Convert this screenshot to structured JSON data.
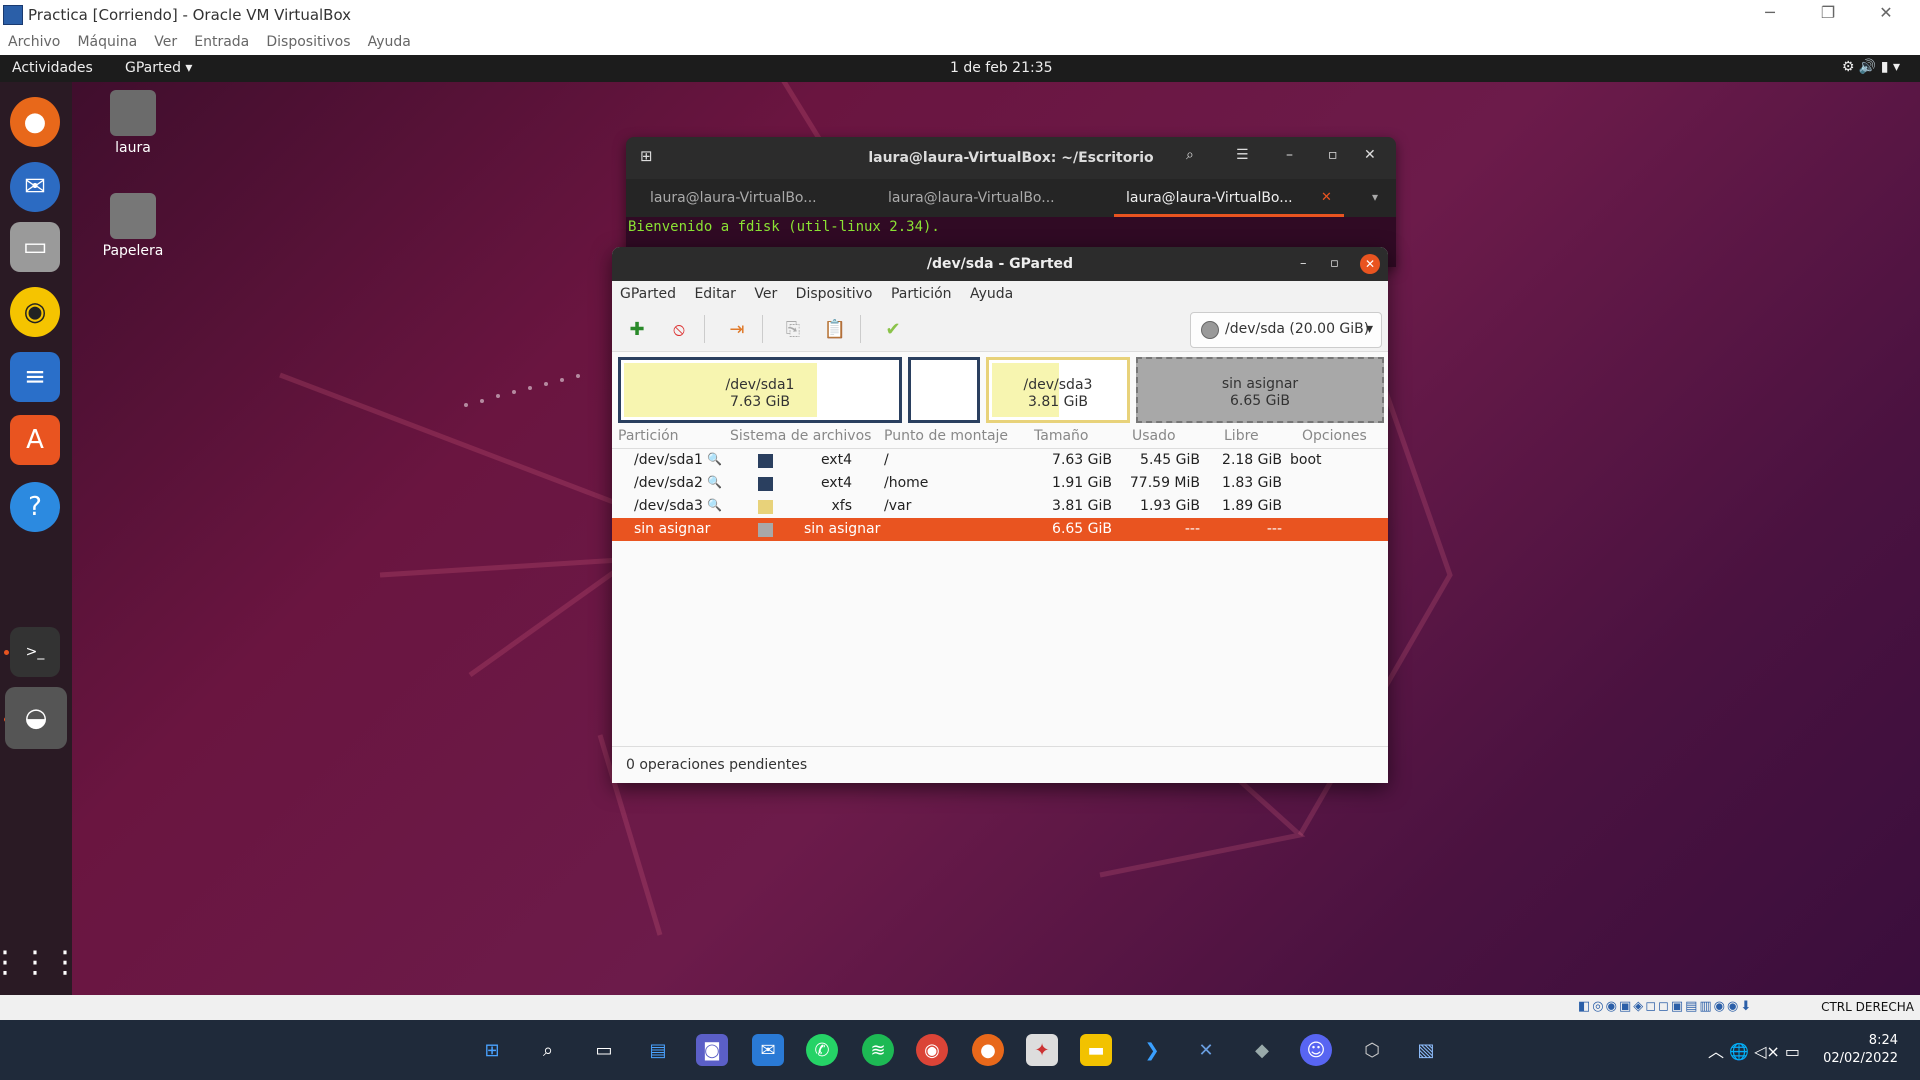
{
  "vbox": {
    "title": "Practica [Corriendo] - Oracle VM VirtualBox",
    "menu": [
      "Archivo",
      "Máquina",
      "Ver",
      "Entrada",
      "Dispositivos",
      "Ayuda"
    ],
    "host_key": "CTRL DERECHA"
  },
  "ubuntu": {
    "activities": "Actividades",
    "app_menu": "GParted ▾",
    "clock": "1 de feb  21:35"
  },
  "desktop": {
    "home_label": "laura",
    "trash_label": "Papelera"
  },
  "terminal": {
    "title": "laura@laura-VirtualBox: ~/Escritorio",
    "tabs": [
      "laura@laura-VirtualBo...",
      "laura@laura-VirtualBo...",
      "laura@laura-VirtualBo..."
    ],
    "output": "Bienvenido a fdisk (util-linux 2.34)."
  },
  "gparted": {
    "title": "/dev/sda - GParted",
    "menu": [
      "GParted",
      "Editar",
      "Ver",
      "Dispositivo",
      "Partición",
      "Ayuda"
    ],
    "device": "/dev/sda (20.00 GiB)",
    "map": [
      {
        "name": "/dev/sda1",
        "size": "7.63 GiB",
        "used_fraction": 0.71
      },
      {
        "name": "",
        "size": "",
        "used_fraction": 0
      },
      {
        "name": "/dev/sda3",
        "size": "3.81 GiB",
        "used_fraction": 0.51
      },
      {
        "name": "sin asignar",
        "size": "6.65 GiB",
        "used_fraction": 0
      }
    ],
    "columns": [
      "Partición",
      "Sistema de archivos",
      "Punto de montaje",
      "Tamaño",
      "Usado",
      "Libre",
      "Opciones"
    ],
    "rows": [
      {
        "partition": "/dev/sda1",
        "fs": "ext4",
        "mount": "/",
        "size": "7.63 GiB",
        "used": "5.45 GiB",
        "free": "2.18 GiB",
        "flags": "boot",
        "color": "#2a3f5f"
      },
      {
        "partition": "/dev/sda2",
        "fs": "ext4",
        "mount": "/home",
        "size": "1.91 GiB",
        "used": "77.59 MiB",
        "free": "1.83 GiB",
        "flags": "",
        "color": "#2a3f5f"
      },
      {
        "partition": "/dev/sda3",
        "fs": "xfs",
        "mount": "/var",
        "size": "3.81 GiB",
        "used": "1.93 GiB",
        "free": "1.89 GiB",
        "flags": "",
        "color": "#e8d27a"
      },
      {
        "partition": "sin asignar",
        "fs": "sin asignar",
        "mount": "",
        "size": "6.65 GiB",
        "used": "---",
        "free": "---",
        "flags": "",
        "color": "#a8a8a8"
      }
    ],
    "status": "0 operaciones pendientes"
  },
  "taskbar": {
    "time": "8:24",
    "date": "02/02/2022"
  }
}
